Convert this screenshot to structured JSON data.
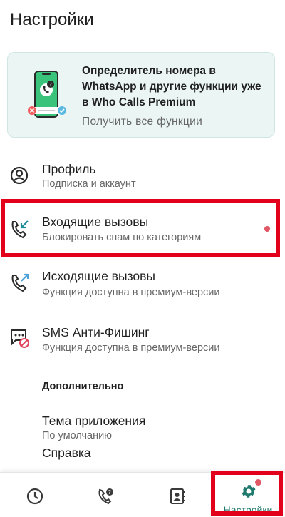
{
  "header": {
    "title": "Настройки"
  },
  "promo": {
    "title": "Определитель номера в WhatsApp и другие функции уже в Who Calls Premium",
    "cta": "Получить все функции"
  },
  "items": [
    {
      "title": "Профиль",
      "subtitle": "Подписка и аккаунт",
      "icon": "account-circle-icon"
    },
    {
      "title": "Входящие вызовы",
      "subtitle": "Блокировать спам по категориям",
      "icon": "incoming-call-icon"
    },
    {
      "title": "Исходящие вызовы",
      "subtitle": "Функция доступна в премиум-версии",
      "icon": "outgoing-call-icon"
    },
    {
      "title": "SMS Анти-Фишинг",
      "subtitle": "Функция доступна в премиум-версии",
      "icon": "sms-antiphishing-icon"
    }
  ],
  "section": {
    "title": "Дополнительно"
  },
  "extra_items": [
    {
      "title": "Тема приложения",
      "subtitle": "По умолчанию"
    },
    {
      "title": "Справка"
    }
  ],
  "bottom_nav": {
    "items": [
      {
        "icon": "clock-icon"
      },
      {
        "icon": "phone-question-icon"
      },
      {
        "icon": "contacts-icon"
      },
      {
        "icon": "gear-icon",
        "label": "Настройки"
      }
    ]
  },
  "colors": {
    "accent": "#1f7a6e",
    "highlight": "#e2001a",
    "badge": "#e05766",
    "promo_bg": "#eaf5f4"
  }
}
